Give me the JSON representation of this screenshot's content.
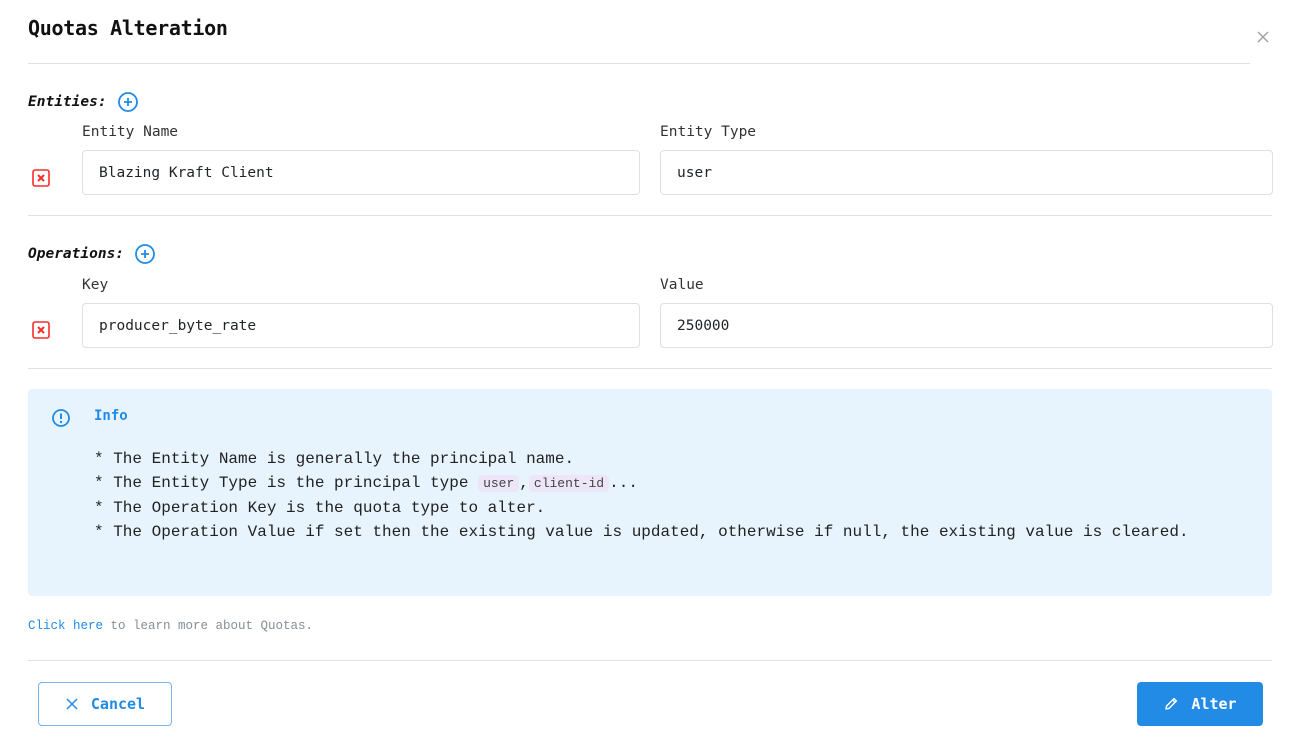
{
  "dialog": {
    "title": "Quotas Alteration",
    "close_icon": "close-icon"
  },
  "entities": {
    "heading": "Entities:",
    "add_icon": "plus-circle-icon",
    "name_label": "Entity Name",
    "type_label": "Entity Type",
    "rows": [
      {
        "name": "Blazing Kraft Client",
        "type": "user",
        "remove_icon": "square-x-icon"
      }
    ]
  },
  "operations": {
    "heading": "Operations:",
    "add_icon": "plus-circle-icon",
    "key_label": "Key",
    "value_label": "Value",
    "rows": [
      {
        "key": "producer_byte_rate",
        "value": "250000",
        "remove_icon": "square-x-icon"
      }
    ]
  },
  "info": {
    "icon": "info-circle-icon",
    "title": "Info",
    "line1": "* The Entity Name is generally the principal name.",
    "line2_prefix": "* The Entity Type is the principal type ",
    "line2_code1": "user",
    "line2_sep": ",",
    "line2_code2": "client-id",
    "line2_suffix": "...",
    "line3": "* The Operation Key is the quota type to alter.",
    "line4": "* The Operation Value if set then the existing value is updated, otherwise if null, the existing value is cleared."
  },
  "learn_more": {
    "link_text": "Click here",
    "rest_text": " to learn more about Quotas."
  },
  "footer": {
    "cancel_label": "Cancel",
    "cancel_icon": "x-icon",
    "alter_label": "Alter",
    "alter_icon": "pencil-icon"
  },
  "colors": {
    "accent": "#228be6",
    "danger": "#fa2d2d",
    "info_bg": "#e7f4fe",
    "code_bg": "#ede5f8"
  }
}
